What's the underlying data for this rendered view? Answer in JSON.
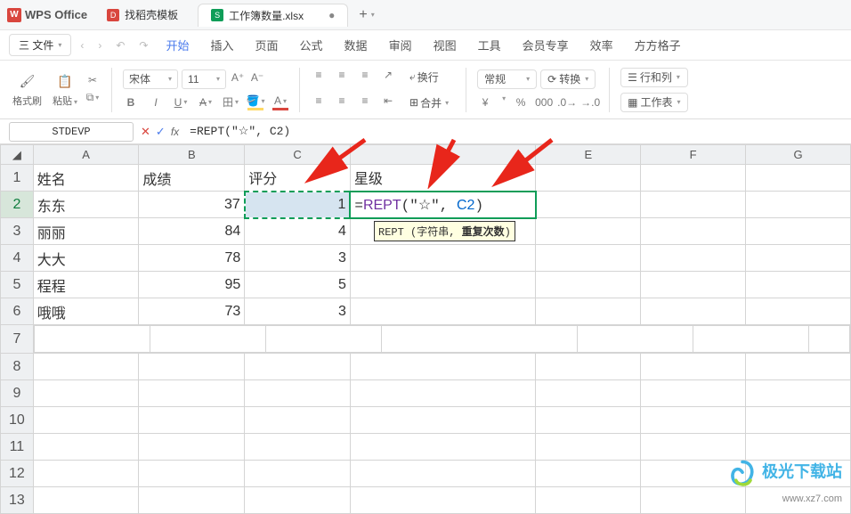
{
  "title_bar": {
    "app_name": "WPS Office"
  },
  "tabs": [
    {
      "label": "找稻壳模板",
      "icon_color": "red"
    },
    {
      "label": "工作簿数量.xlsx",
      "icon_text": "S",
      "icon_color": "green",
      "active": true,
      "dirty": "●"
    }
  ],
  "menu": {
    "file": "三 文件",
    "items": [
      "开始",
      "插入",
      "页面",
      "公式",
      "数据",
      "审阅",
      "视图",
      "工具",
      "会员专享",
      "效率",
      "方方格子"
    ]
  },
  "ribbon": {
    "format_painter": "格式刷",
    "paste": "粘贴",
    "font_name": "宋体",
    "font_size": "11",
    "bigger": "A⁺",
    "smaller": "A⁻",
    "wrap": "换行",
    "merge": "合并",
    "general": "常规",
    "convert": "转换",
    "rowcol": "行和列",
    "sheet": "工作表",
    "currency": "¥",
    "percent": "%",
    "comma": "000",
    "dec_inc": ".0→",
    "dec_dec": "→.0"
  },
  "formula_bar": {
    "name_box": "STDEVP",
    "formula": "=REPT(\"☆\", C2)"
  },
  "columns": [
    "A",
    "B",
    "C",
    "D",
    "E",
    "F",
    "G"
  ],
  "rows": [
    "1",
    "2",
    "3",
    "4",
    "5",
    "6",
    "7",
    "8",
    "9",
    "10",
    "11",
    "12",
    "13"
  ],
  "headers": {
    "A": "姓名",
    "B": "成绩",
    "C": "评分",
    "D": "星级"
  },
  "data": [
    {
      "A": "东东",
      "B": "37",
      "C": "1",
      "D_formula": "=REPT(\"☆\", C2)"
    },
    {
      "A": "丽丽",
      "B": "84",
      "C": "4"
    },
    {
      "A": "大大",
      "B": "78",
      "C": "3"
    },
    {
      "A": "程程",
      "B": "95",
      "C": "5"
    },
    {
      "A": "哦哦",
      "B": "73",
      "C": "3"
    }
  ],
  "tooltip": "REPT (字符串, 重复次数)",
  "watermark": {
    "name": "极光下载站",
    "url": "www.xz7.com"
  }
}
